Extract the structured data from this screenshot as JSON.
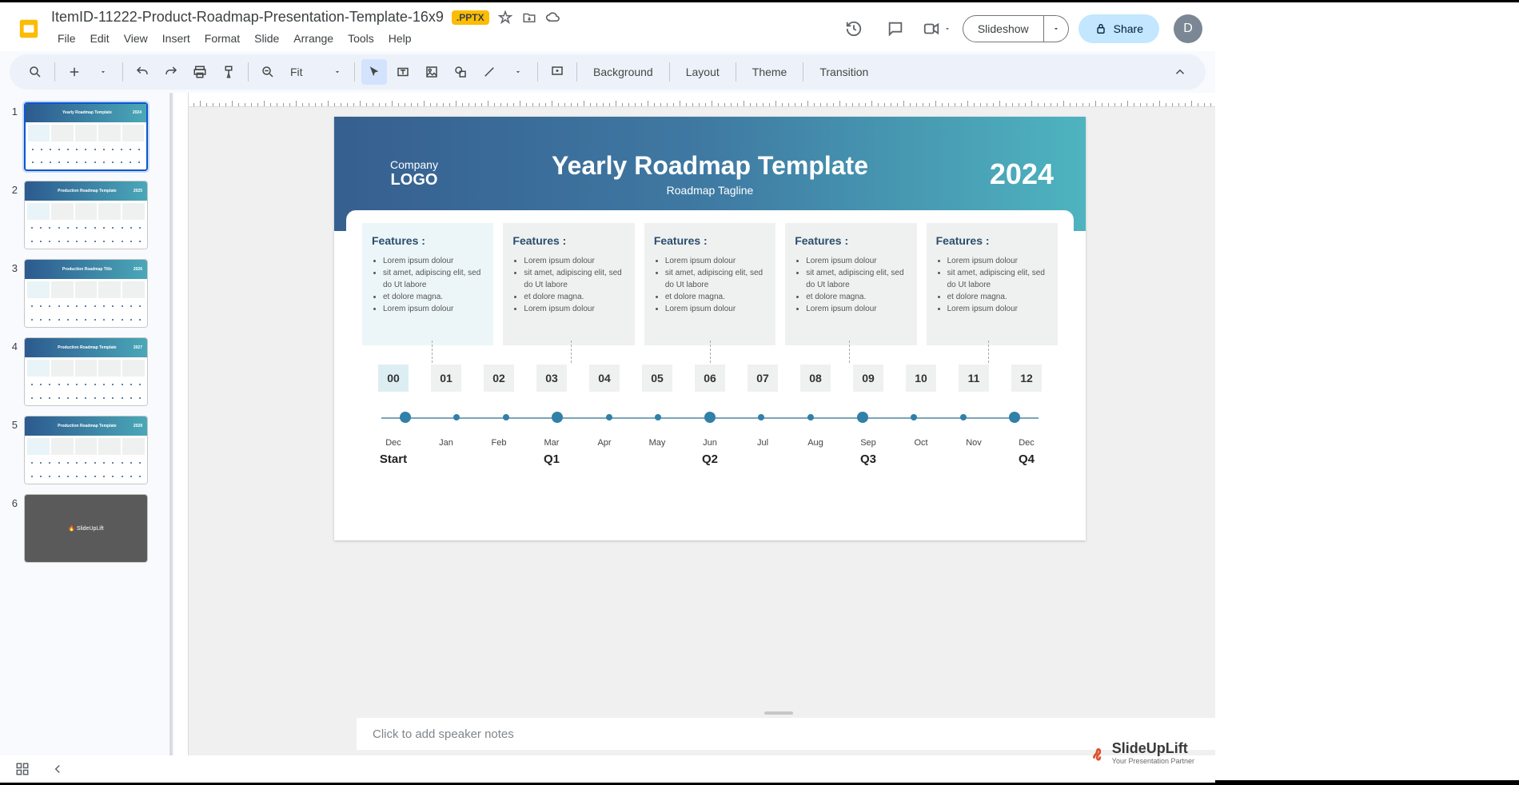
{
  "doc": {
    "title": "ItemID-11222-Product-Roadmap-Presentation-Template-16x9",
    "badge": ".PPTX"
  },
  "menus": [
    "File",
    "Edit",
    "View",
    "Insert",
    "Format",
    "Slide",
    "Arrange",
    "Tools",
    "Help"
  ],
  "header": {
    "slideshow": "Slideshow",
    "share": "Share",
    "avatar": "D"
  },
  "toolbar": {
    "zoom": "Fit",
    "background": "Background",
    "layout": "Layout",
    "theme": "Theme",
    "transition": "Transition"
  },
  "slides": [
    {
      "num": "1",
      "title": "Yearly Roadmap Template",
      "year": "2024",
      "active": true
    },
    {
      "num": "2",
      "title": "Production Roadmap Template",
      "year": "2025"
    },
    {
      "num": "3",
      "title": "Production Roadmap Title",
      "year": "2026"
    },
    {
      "num": "4",
      "title": "Production Roadmap Template",
      "year": "2027"
    },
    {
      "num": "5",
      "title": "Production Roadmap Template",
      "year": "2028"
    },
    {
      "num": "6",
      "title": "SlideUpLift",
      "dark": true
    }
  ],
  "slide": {
    "company": "Company",
    "logo": "LOGO",
    "title": "Yearly Roadmap Template",
    "tagline": "Roadmap Tagline",
    "year": "2024",
    "feature_heading": "Features :",
    "feature_bullets": [
      "Lorem ipsum dolour",
      "sit amet, adipiscing elit, sed do Ut labore",
      "et dolore magna.",
      "Lorem ipsum dolour"
    ],
    "numbers": [
      "00",
      "01",
      "02",
      "03",
      "04",
      "05",
      "06",
      "07",
      "08",
      "09",
      "10",
      "11",
      "12"
    ],
    "months": [
      "Dec",
      "Jan",
      "Feb",
      "Mar",
      "Apr",
      "May",
      "Jun",
      "Jul",
      "Aug",
      "Sep",
      "Oct",
      "Nov",
      "Dec"
    ],
    "quarters": [
      "Start",
      "",
      "",
      "Q1",
      "",
      "",
      "Q2",
      "",
      "",
      "Q3",
      "",
      "",
      "Q4"
    ],
    "big_dots": [
      0,
      3,
      6,
      9,
      12
    ]
  },
  "notes": {
    "placeholder": "Click to add speaker notes"
  },
  "watermark": {
    "title": "SlideUpLift",
    "sub": "Your Presentation Partner"
  }
}
